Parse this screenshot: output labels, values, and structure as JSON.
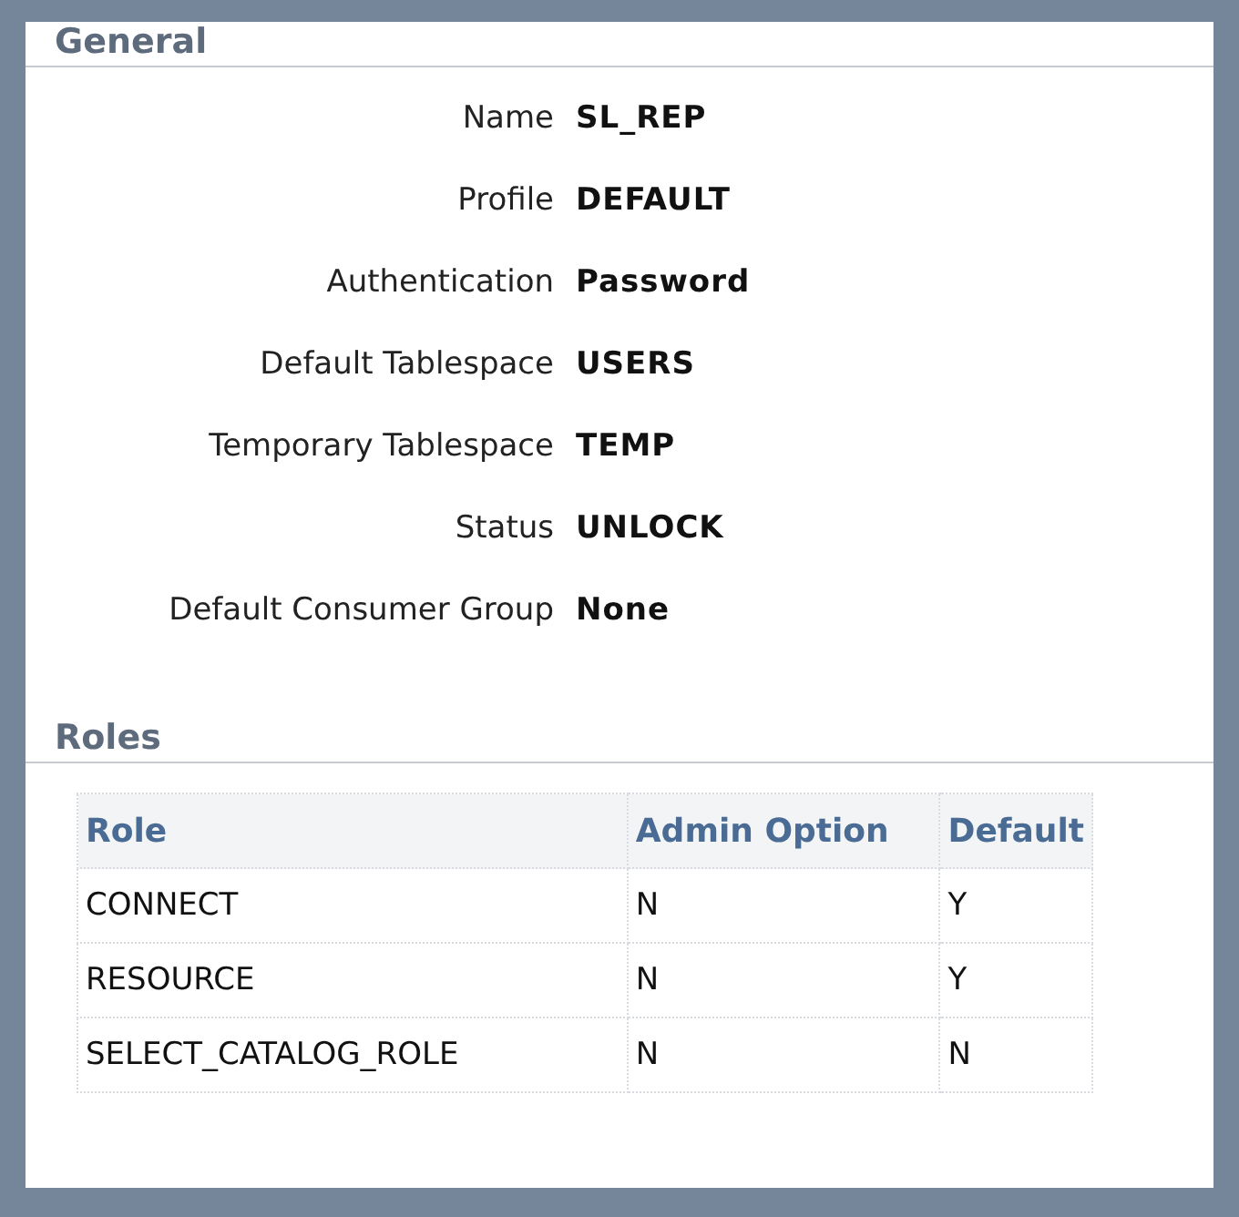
{
  "general": {
    "title": "General",
    "fields": [
      {
        "label": "Name",
        "value": "SL_REP"
      },
      {
        "label": "Profile",
        "value": "DEFAULT"
      },
      {
        "label": "Authentication",
        "value": "Password"
      },
      {
        "label": "Default Tablespace",
        "value": "USERS"
      },
      {
        "label": "Temporary Tablespace",
        "value": "TEMP"
      },
      {
        "label": "Status",
        "value": "UNLOCK"
      },
      {
        "label": "Default Consumer Group",
        "value": "None"
      }
    ]
  },
  "roles": {
    "title": "Roles",
    "columns": [
      "Role",
      "Admin Option",
      "Default"
    ],
    "rows": [
      [
        "CONNECT",
        "N",
        "Y"
      ],
      [
        "RESOURCE",
        "N",
        "Y"
      ],
      [
        "SELECT_CATALOG_ROLE",
        "N",
        "N"
      ]
    ]
  }
}
